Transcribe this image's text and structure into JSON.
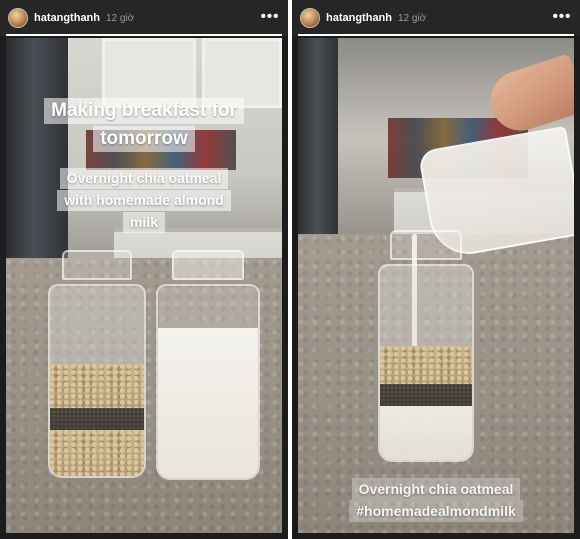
{
  "stories": [
    {
      "user": {
        "username": "hatangthanh",
        "time": "12 giờ"
      },
      "more_label": "•••",
      "progress": 1.0,
      "captions": [
        "Making breakfast for",
        "tomorrow",
        "Overnight chia oatmeal",
        "with homemade almond",
        "milk"
      ]
    },
    {
      "user": {
        "username": "hatangthanh",
        "time": "12 giờ"
      },
      "more_label": "•••",
      "progress": 1.0,
      "captions": [
        "Overnight chia oatmeal",
        "#homemadealmondmilk"
      ]
    }
  ],
  "colors": {
    "story_background": "#1c1c1c",
    "header_background": "#262626",
    "caption_box": "rgba(255,255,255,0.55)"
  }
}
